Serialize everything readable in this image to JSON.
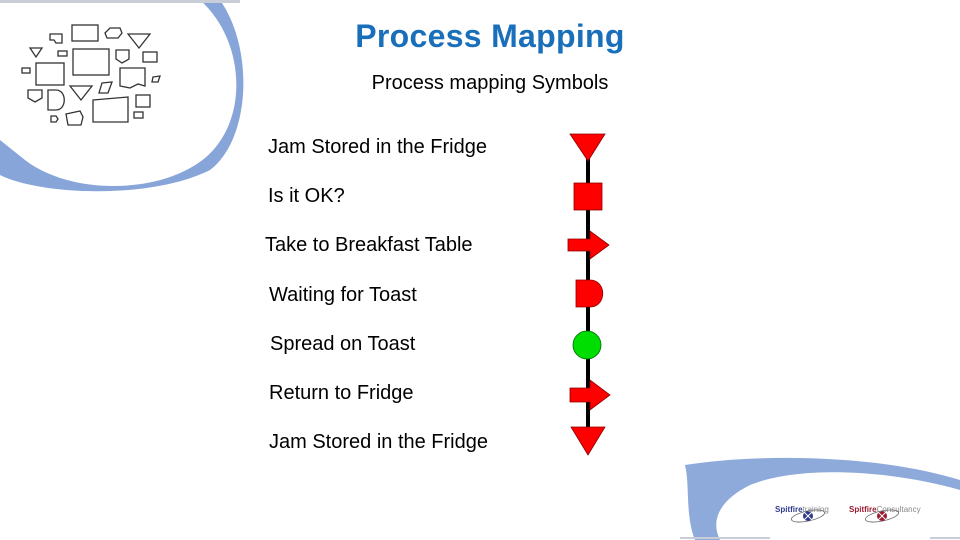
{
  "header": {
    "title": "Process Mapping",
    "subtitle": "Process mapping Symbols"
  },
  "colors": {
    "title": "#1a6fba",
    "symbol_red": "#ff0000",
    "symbol_green": "#00dd00",
    "connector": "#000000",
    "accent_swirl": "#7a9bd4"
  },
  "steps": [
    {
      "label": "Jam Stored in the Fridge",
      "symbol": "storage-triangle",
      "color": "red"
    },
    {
      "label": "Is it OK?",
      "symbol": "inspection-square",
      "color": "red"
    },
    {
      "label": "Take to Breakfast Table",
      "symbol": "transport-arrow",
      "color": "red"
    },
    {
      "label": "Waiting for Toast",
      "symbol": "delay-d-shape",
      "color": "red"
    },
    {
      "label": "Spread on Toast",
      "symbol": "operation-circle",
      "color": "green"
    },
    {
      "label": "Return to Fridge",
      "symbol": "transport-arrow",
      "color": "red"
    },
    {
      "label": "Jam Stored in the Fridge",
      "symbol": "storage-triangle",
      "color": "red"
    }
  ],
  "footer": {
    "logos": [
      {
        "bold": "Spitfire",
        "rest": "training"
      },
      {
        "bold": "Spitfire",
        "rest": "Consultancy"
      }
    ]
  }
}
